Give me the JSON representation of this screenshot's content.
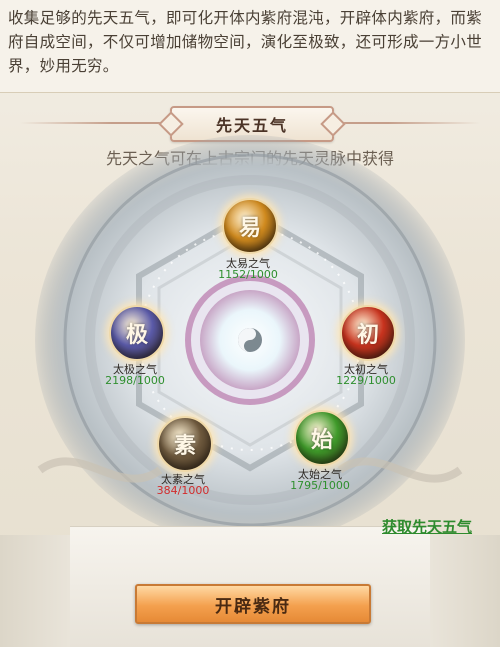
{
  "description": "收集足够的先天五气，即可化开体内紫府混沌，开辟体内紫府，而紫府自成空间，不仅可增加储物空间，演化至极致，还可形成一方小世界，妙用无穷。",
  "section_title": "先天五气",
  "subtitle": "先天之气可在上古宗门的先天灵脉中获得",
  "qi": [
    {
      "char": "易",
      "name": "太易之气",
      "count": "1152/1000",
      "status": "ok",
      "color": "#d08a1e"
    },
    {
      "char": "初",
      "name": "太初之气",
      "count": "1229/1000",
      "status": "ok",
      "color": "#c8331e"
    },
    {
      "char": "始",
      "name": "太始之气",
      "count": "1795/1000",
      "status": "ok",
      "color": "#3f9a2a"
    },
    {
      "char": "素",
      "name": "太素之气",
      "count": "384/1000",
      "status": "bad",
      "color": "#6f5a3e"
    },
    {
      "char": "极",
      "name": "太极之气",
      "count": "2198/1000",
      "status": "ok",
      "color": "#5a5aa8"
    }
  ],
  "obtain_link": "获取先天五气",
  "open_button": "开辟紫府"
}
